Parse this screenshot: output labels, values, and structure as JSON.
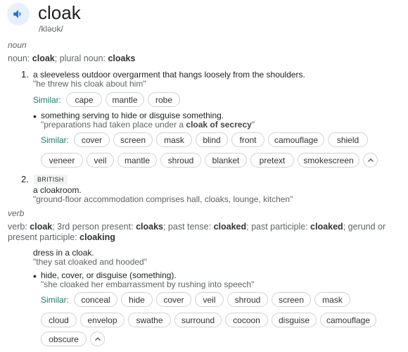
{
  "headword": "cloak",
  "phonetic": "/kləʊk/",
  "noun": {
    "pos": "noun",
    "inflection": {
      "lead": "noun: ",
      "w1": "cloak",
      "mid": "; plural noun: ",
      "w2": "cloaks"
    },
    "s1": {
      "num": "1.",
      "def": "a sleeveless outdoor overgarment that hangs loosely from the shoulders.",
      "ex": "\"he threw his cloak about him\"",
      "similar_label": "Similar:",
      "similar": [
        "cape",
        "mantle",
        "robe"
      ],
      "sub": {
        "def": "something serving to hide or disguise something.",
        "ex_pre": "\"preparations had taken place under a ",
        "ex_bold": "cloak of secrecy",
        "ex_post": "\"",
        "similar_label": "Similar:",
        "row1": [
          "cover",
          "screen",
          "mask",
          "blind",
          "front",
          "camouflage",
          "shield"
        ],
        "row2": [
          "veneer",
          "veil",
          "mantle",
          "shroud",
          "blanket",
          "pretext",
          "smokescreen"
        ]
      }
    },
    "s2": {
      "num": "2.",
      "badge": "BRITISH",
      "def": "a cloakroom.",
      "ex": "\"ground-floor accommodation comprises hall, cloaks, lounge, kitchen\""
    }
  },
  "verb": {
    "pos": "verb",
    "inflection": {
      "p1": "verb: ",
      "b1": "cloak",
      "p2": "; 3rd person present: ",
      "b2": "cloaks",
      "p3": "; past tense: ",
      "b3": "cloaked",
      "p4": "; past participle: ",
      "b4": "cloaked",
      "p5": "; gerund or",
      "p6": "present participle: ",
      "b5": "cloaking"
    },
    "s1": {
      "def": "dress in a cloak.",
      "ex": "\"they sat cloaked and hooded\"",
      "sub": {
        "def": "hide, cover, or disguise (something).",
        "ex": "\"she cloaked her embarrassment by rushing into speech\"",
        "similar_label": "Similar:",
        "row1": [
          "conceal",
          "hide",
          "cover",
          "veil",
          "shroud",
          "screen",
          "mask"
        ],
        "row2": [
          "cloud",
          "envelop",
          "swathe",
          "surround",
          "cocoon",
          "disguise",
          "camouflage"
        ],
        "row3": [
          "obscure"
        ]
      }
    }
  },
  "colors": {
    "accent": "#1a73e8",
    "similar": "#1a7f6f",
    "muted": "#5f6368"
  },
  "icons": {
    "speaker": "speaker-icon",
    "chevron": "chevron-up-icon"
  }
}
